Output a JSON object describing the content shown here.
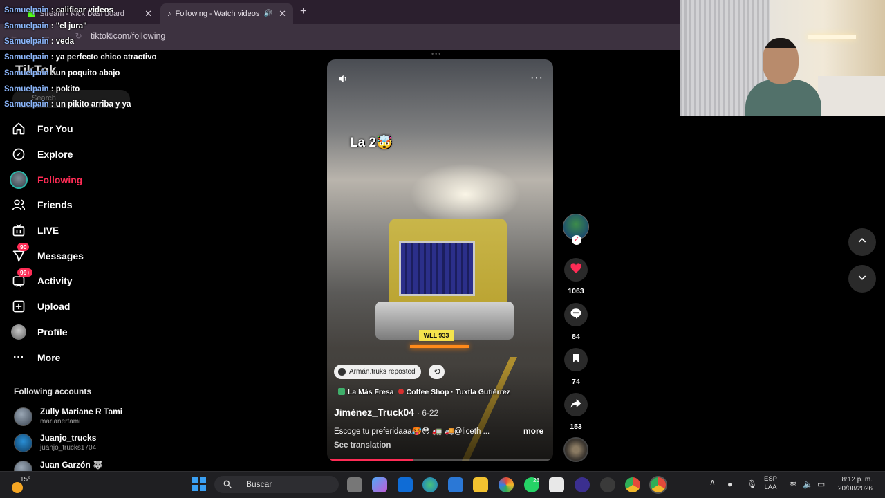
{
  "browser": {
    "tabs": [
      {
        "label": "Stream - Kick Dashboard",
        "close": "✕"
      },
      {
        "label": "Following - Watch videos fr",
        "close": "✕"
      }
    ],
    "new_tab": "+",
    "url": "tiktok.com/following"
  },
  "chat": [
    {
      "user": "Samuelpain",
      "msg": ": calificar videos"
    },
    {
      "user": "Samuelpain",
      "msg": ": \"el jura\""
    },
    {
      "user": "Samuelpain",
      "msg": ": veda"
    },
    {
      "user": "Samuelpain",
      "msg": ": ya perfecto chico atractivo"
    },
    {
      "user": "Samuelpain",
      "msg": ": un poquito abajo"
    },
    {
      "user": "Samuelpain",
      "msg": ": pokito"
    },
    {
      "user": "Samuelpain",
      "msg": ": un pikito arriba y ya"
    }
  ],
  "tiktok": {
    "logo": "TikTok",
    "search_placeholder": "Search",
    "nav": [
      {
        "label": "For You",
        "icon": "home-icon"
      },
      {
        "label": "Explore",
        "icon": "compass-icon"
      },
      {
        "label": "Following",
        "icon": "following-avatar-icon",
        "active": true
      },
      {
        "label": "Friends",
        "icon": "friends-icon"
      },
      {
        "label": "LIVE",
        "icon": "live-icon"
      },
      {
        "label": "Messages",
        "icon": "messages-icon",
        "badge": "90"
      },
      {
        "label": "Activity",
        "icon": "activity-icon",
        "badge": "99+"
      },
      {
        "label": "Upload",
        "icon": "upload-icon"
      },
      {
        "label": "Profile",
        "icon": "profile-icon"
      },
      {
        "label": "More",
        "icon": "more-icon"
      }
    ],
    "following_title": "Following accounts",
    "accounts": [
      {
        "name": "Zully Mariane R Tami",
        "handle": "marianertami"
      },
      {
        "name": "Juanjo_trucks",
        "handle": "juanjo_trucks1704"
      },
      {
        "name": "Juan Garzón 🐺",
        "handle": ""
      }
    ]
  },
  "video": {
    "overlay_text": "La 2🤯",
    "menu": "···",
    "plate": "WLL 933",
    "repost_label": "Armán.truks reposted",
    "location_a": "La Más Fresa",
    "location_b": "Coffee Shop · Tuxtla Gutiérrez",
    "author": "Jiménez_Truck04",
    "date": "· 6-22",
    "caption": "Escoge tu preferidaaa🥵😳 🚛 🚚@liceth ...",
    "more": "more",
    "see_translation": "See translation",
    "progress": 0.38
  },
  "actions": {
    "likes": "1063",
    "comments": "84",
    "saves": "74",
    "shares": "153"
  },
  "taskbar": {
    "weather": "15°",
    "search": "Buscar",
    "lang_top": "ESP",
    "lang_bottom": "LAA",
    "time": "8:12 p. m.",
    "date": "20/08/2026",
    "notif_count": "23"
  },
  "colors": {
    "accent": "#fe2c55",
    "chat_user": "#8ab4f8",
    "browser_frame": "#2b1f2e"
  }
}
